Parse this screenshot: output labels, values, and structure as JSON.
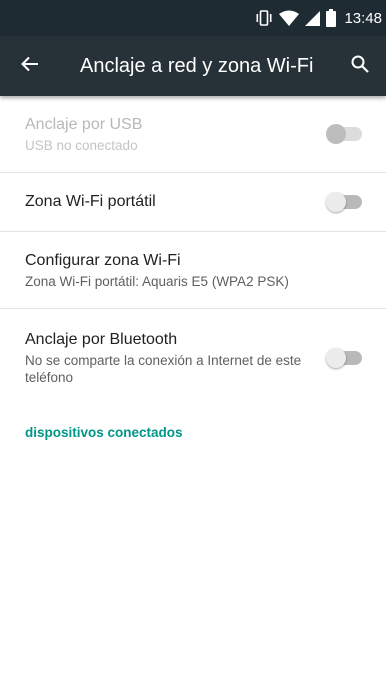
{
  "status_bar": {
    "time": "13:48",
    "icons": [
      "vibrate-icon",
      "wifi-icon",
      "signal-icon",
      "battery-icon"
    ]
  },
  "toolbar": {
    "title": "Anclaje a red y zona Wi-Fi",
    "back_icon": "arrow-back-icon",
    "search_icon": "search-icon",
    "background": "#263238"
  },
  "settings": [
    {
      "title": "Anclaje por USB",
      "summary": "USB no conectado",
      "enabled": false,
      "switch": "off"
    },
    {
      "title": "Zona Wi-Fi portátil",
      "summary": "",
      "enabled": true,
      "switch": "off"
    },
    {
      "title": "Configurar zona Wi-Fi",
      "summary": "Zona Wi-Fi portátil: Aquaris E5 (WPA2 PSK)",
      "enabled": true
    },
    {
      "title": "Anclaje por Bluetooth",
      "summary": "No se comparte la conexión a Internet de este teléfono",
      "enabled": true,
      "switch": "off"
    }
  ],
  "section_header": "dispositivos conectados",
  "colors": {
    "accent": "#009688",
    "status_bar": "#1f2b33"
  }
}
